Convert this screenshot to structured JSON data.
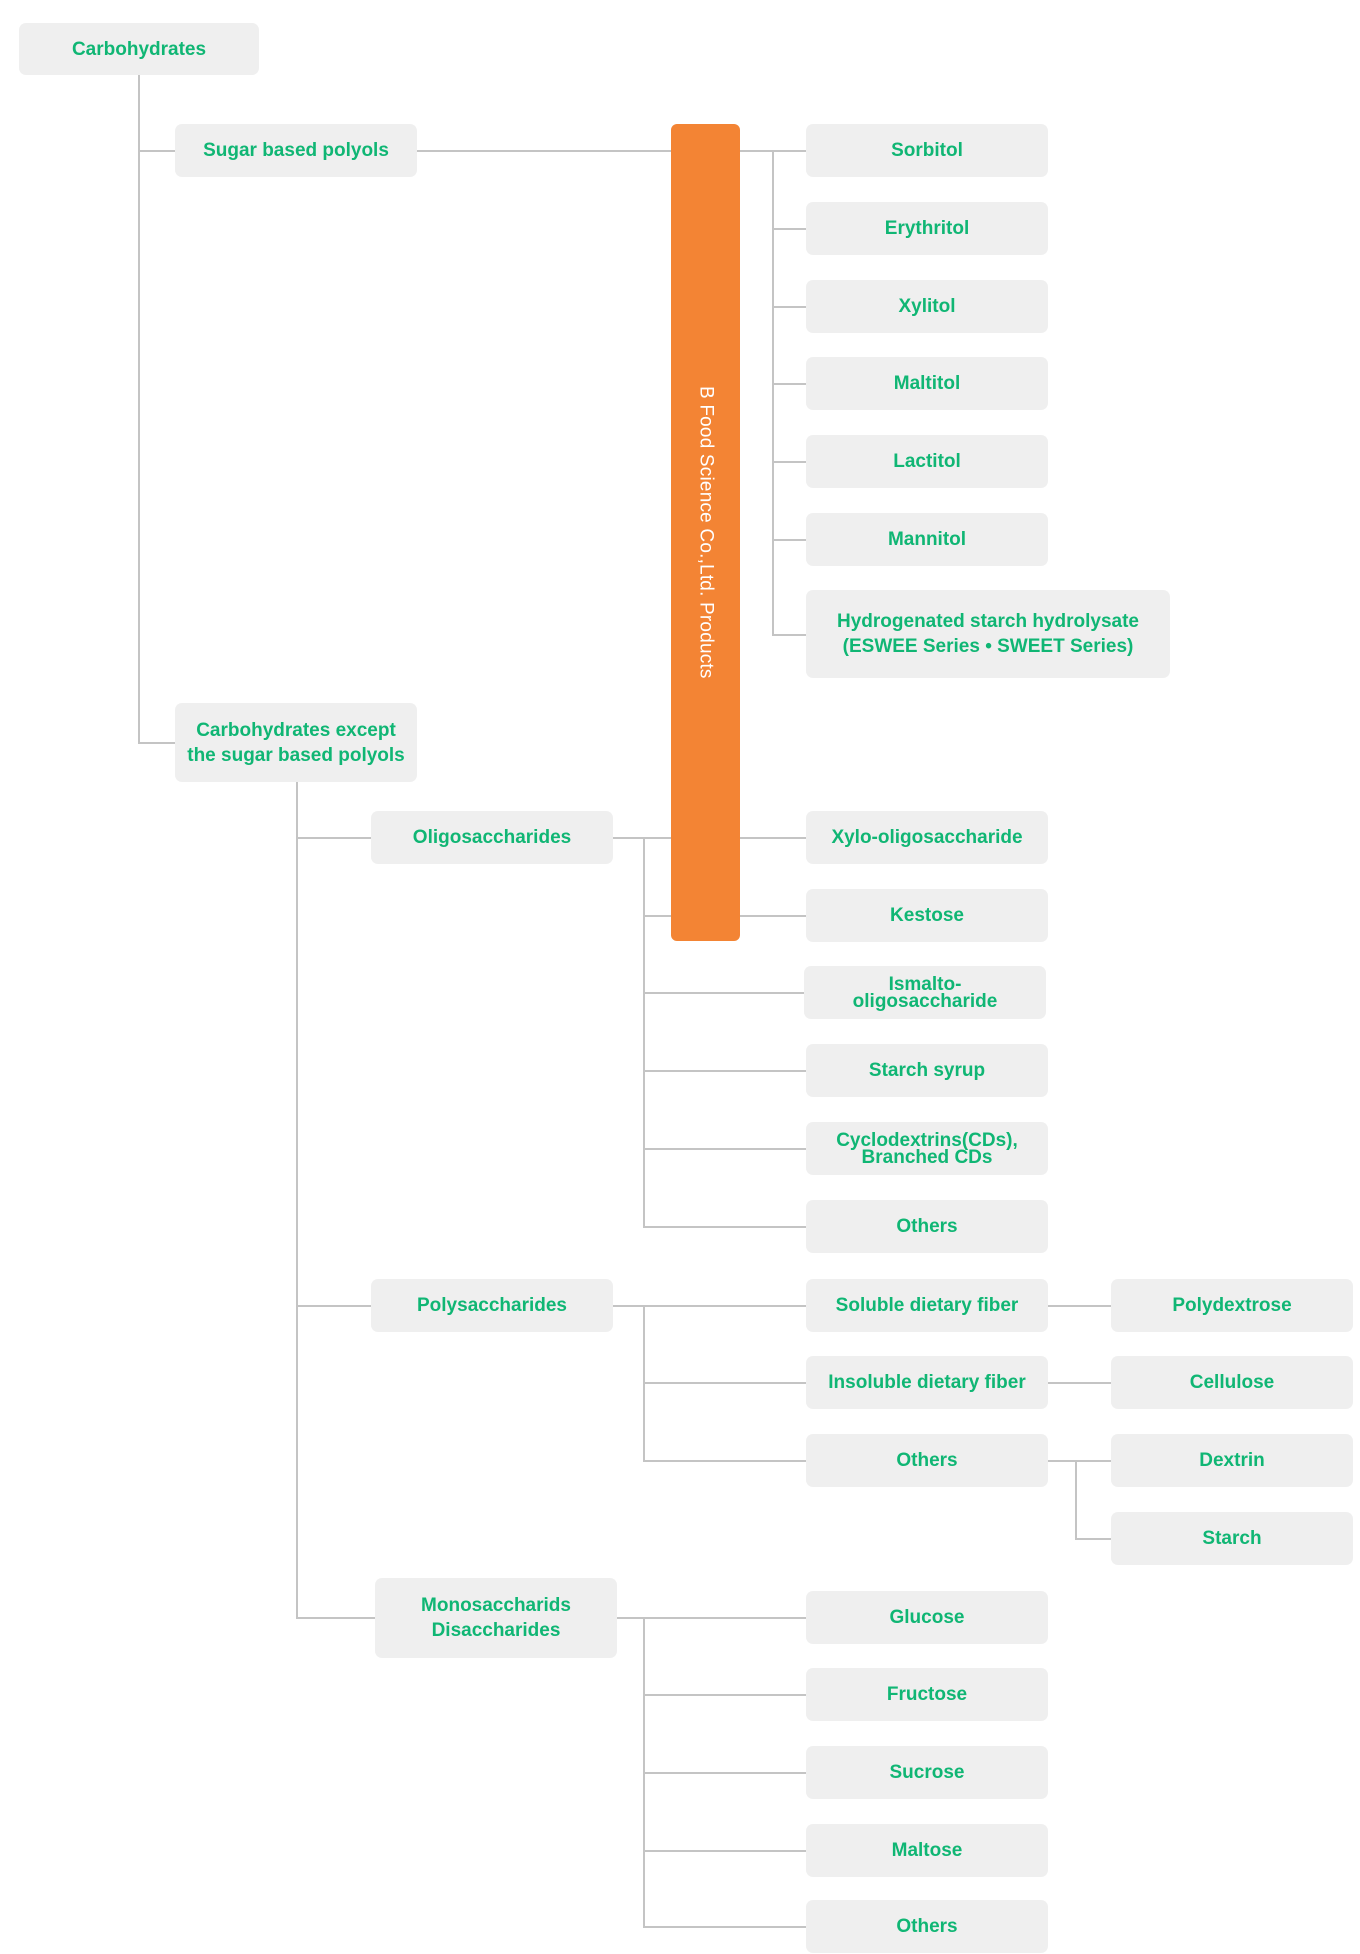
{
  "diagram": {
    "root": "Carbohydrates",
    "highlight_label": "B Food Science Co.,Ltd. Products",
    "colors": {
      "highlight": "#f38434",
      "node_text": "#10b674",
      "node_background": "#efefef",
      "connector": "#c4c4c4"
    },
    "level1": {
      "sugar_polyols": "Sugar based polyols",
      "non_polyols": "Carbohydrates except\nthe sugar based polyols"
    },
    "polyols": [
      "Sorbitol",
      "Erythritol",
      "Xylitol",
      "Maltitol",
      "Lactitol",
      "Mannitol",
      "Hydrogenated starch hydrolysate\n(ESWEE Series • SWEET Series)"
    ],
    "level2": {
      "oligosaccharides": "Oligosaccharides",
      "polysaccharides": "Polysaccharides",
      "mono_di": "Monosaccharids\nDisaccharides"
    },
    "oligosaccharides": [
      "Xylo-oligosaccharide",
      "Kestose",
      "Ismalto-\noligosaccharide",
      "Starch syrup",
      "Cyclodextrins(CDs),\nBranched CDs",
      "Others"
    ],
    "polysaccharides": [
      {
        "label": "Soluble dietary fiber",
        "children": [
          "Polydextrose"
        ]
      },
      {
        "label": "Insoluble dietary fiber",
        "children": [
          "Cellulose"
        ]
      },
      {
        "label": "Others",
        "children": [
          "Dextrin",
          "Starch"
        ]
      }
    ],
    "mono_di": [
      "Glucose",
      "Fructose",
      "Sucrose",
      "Maltose",
      "Others"
    ],
    "highlighted_products": [
      "Sorbitol",
      "Erythritol",
      "Xylitol",
      "Maltitol",
      "Lactitol",
      "Mannitol",
      "Hydrogenated starch hydrolysate",
      "Xylo-oligosaccharide",
      "Kestose"
    ]
  }
}
